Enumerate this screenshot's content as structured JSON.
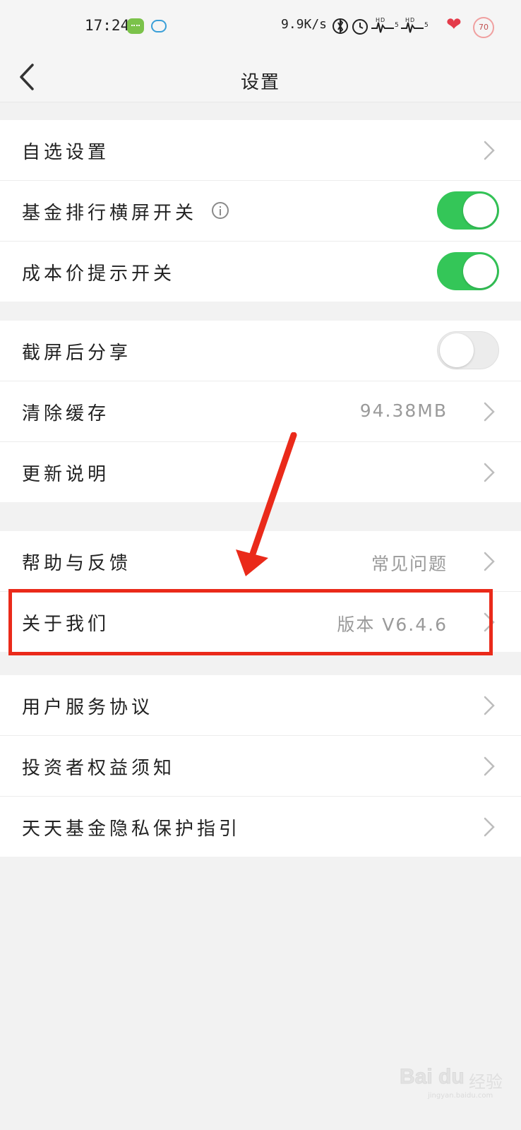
{
  "status_bar": {
    "time": "17:24",
    "net_speed": "9.9K/s",
    "icons": [
      "message-icon",
      "chat-icon",
      "bluetooth-icon",
      "alarm-icon",
      "signal-hd-icon",
      "signal-hd-icon",
      "heart-icon"
    ],
    "signal_text": "✱ ⏰ ⌇⌇⁵ ⌇⌇⁵",
    "battery": "70"
  },
  "header": {
    "title": "设置"
  },
  "groups": [
    {
      "rows": [
        {
          "label": "自选设置",
          "control": "chevron"
        },
        {
          "label": "基金排行横屏开关",
          "control": "toggle",
          "on": true,
          "info_icon": true
        },
        {
          "label": "成本价提示开关",
          "control": "toggle",
          "on": true
        }
      ]
    },
    {
      "rows": [
        {
          "label": "截屏后分享",
          "control": "toggle",
          "on": false
        },
        {
          "label": "清除缓存",
          "value": "94.38MB",
          "control": "chevron"
        },
        {
          "label": "更新说明",
          "control": "chevron"
        }
      ]
    },
    {
      "rows": [
        {
          "label": "帮助与反馈",
          "value": "常见问题",
          "control": "chevron"
        },
        {
          "label": "关于我们",
          "value": "版本  V6.4.6",
          "control": "chevron"
        }
      ]
    },
    {
      "rows": [
        {
          "label": "用户服务协议",
          "control": "chevron"
        },
        {
          "label": "投资者权益须知",
          "control": "chevron"
        },
        {
          "label": "天天基金隐私保护指引",
          "control": "chevron"
        }
      ]
    }
  ],
  "colors": {
    "toggle_on": "#34c658",
    "highlight": "#ea2a1a",
    "value_text": "#9a9a9a"
  },
  "watermark": {
    "logo": "Bai du",
    "text": "经验",
    "url": "jingyan.baidu.com"
  }
}
